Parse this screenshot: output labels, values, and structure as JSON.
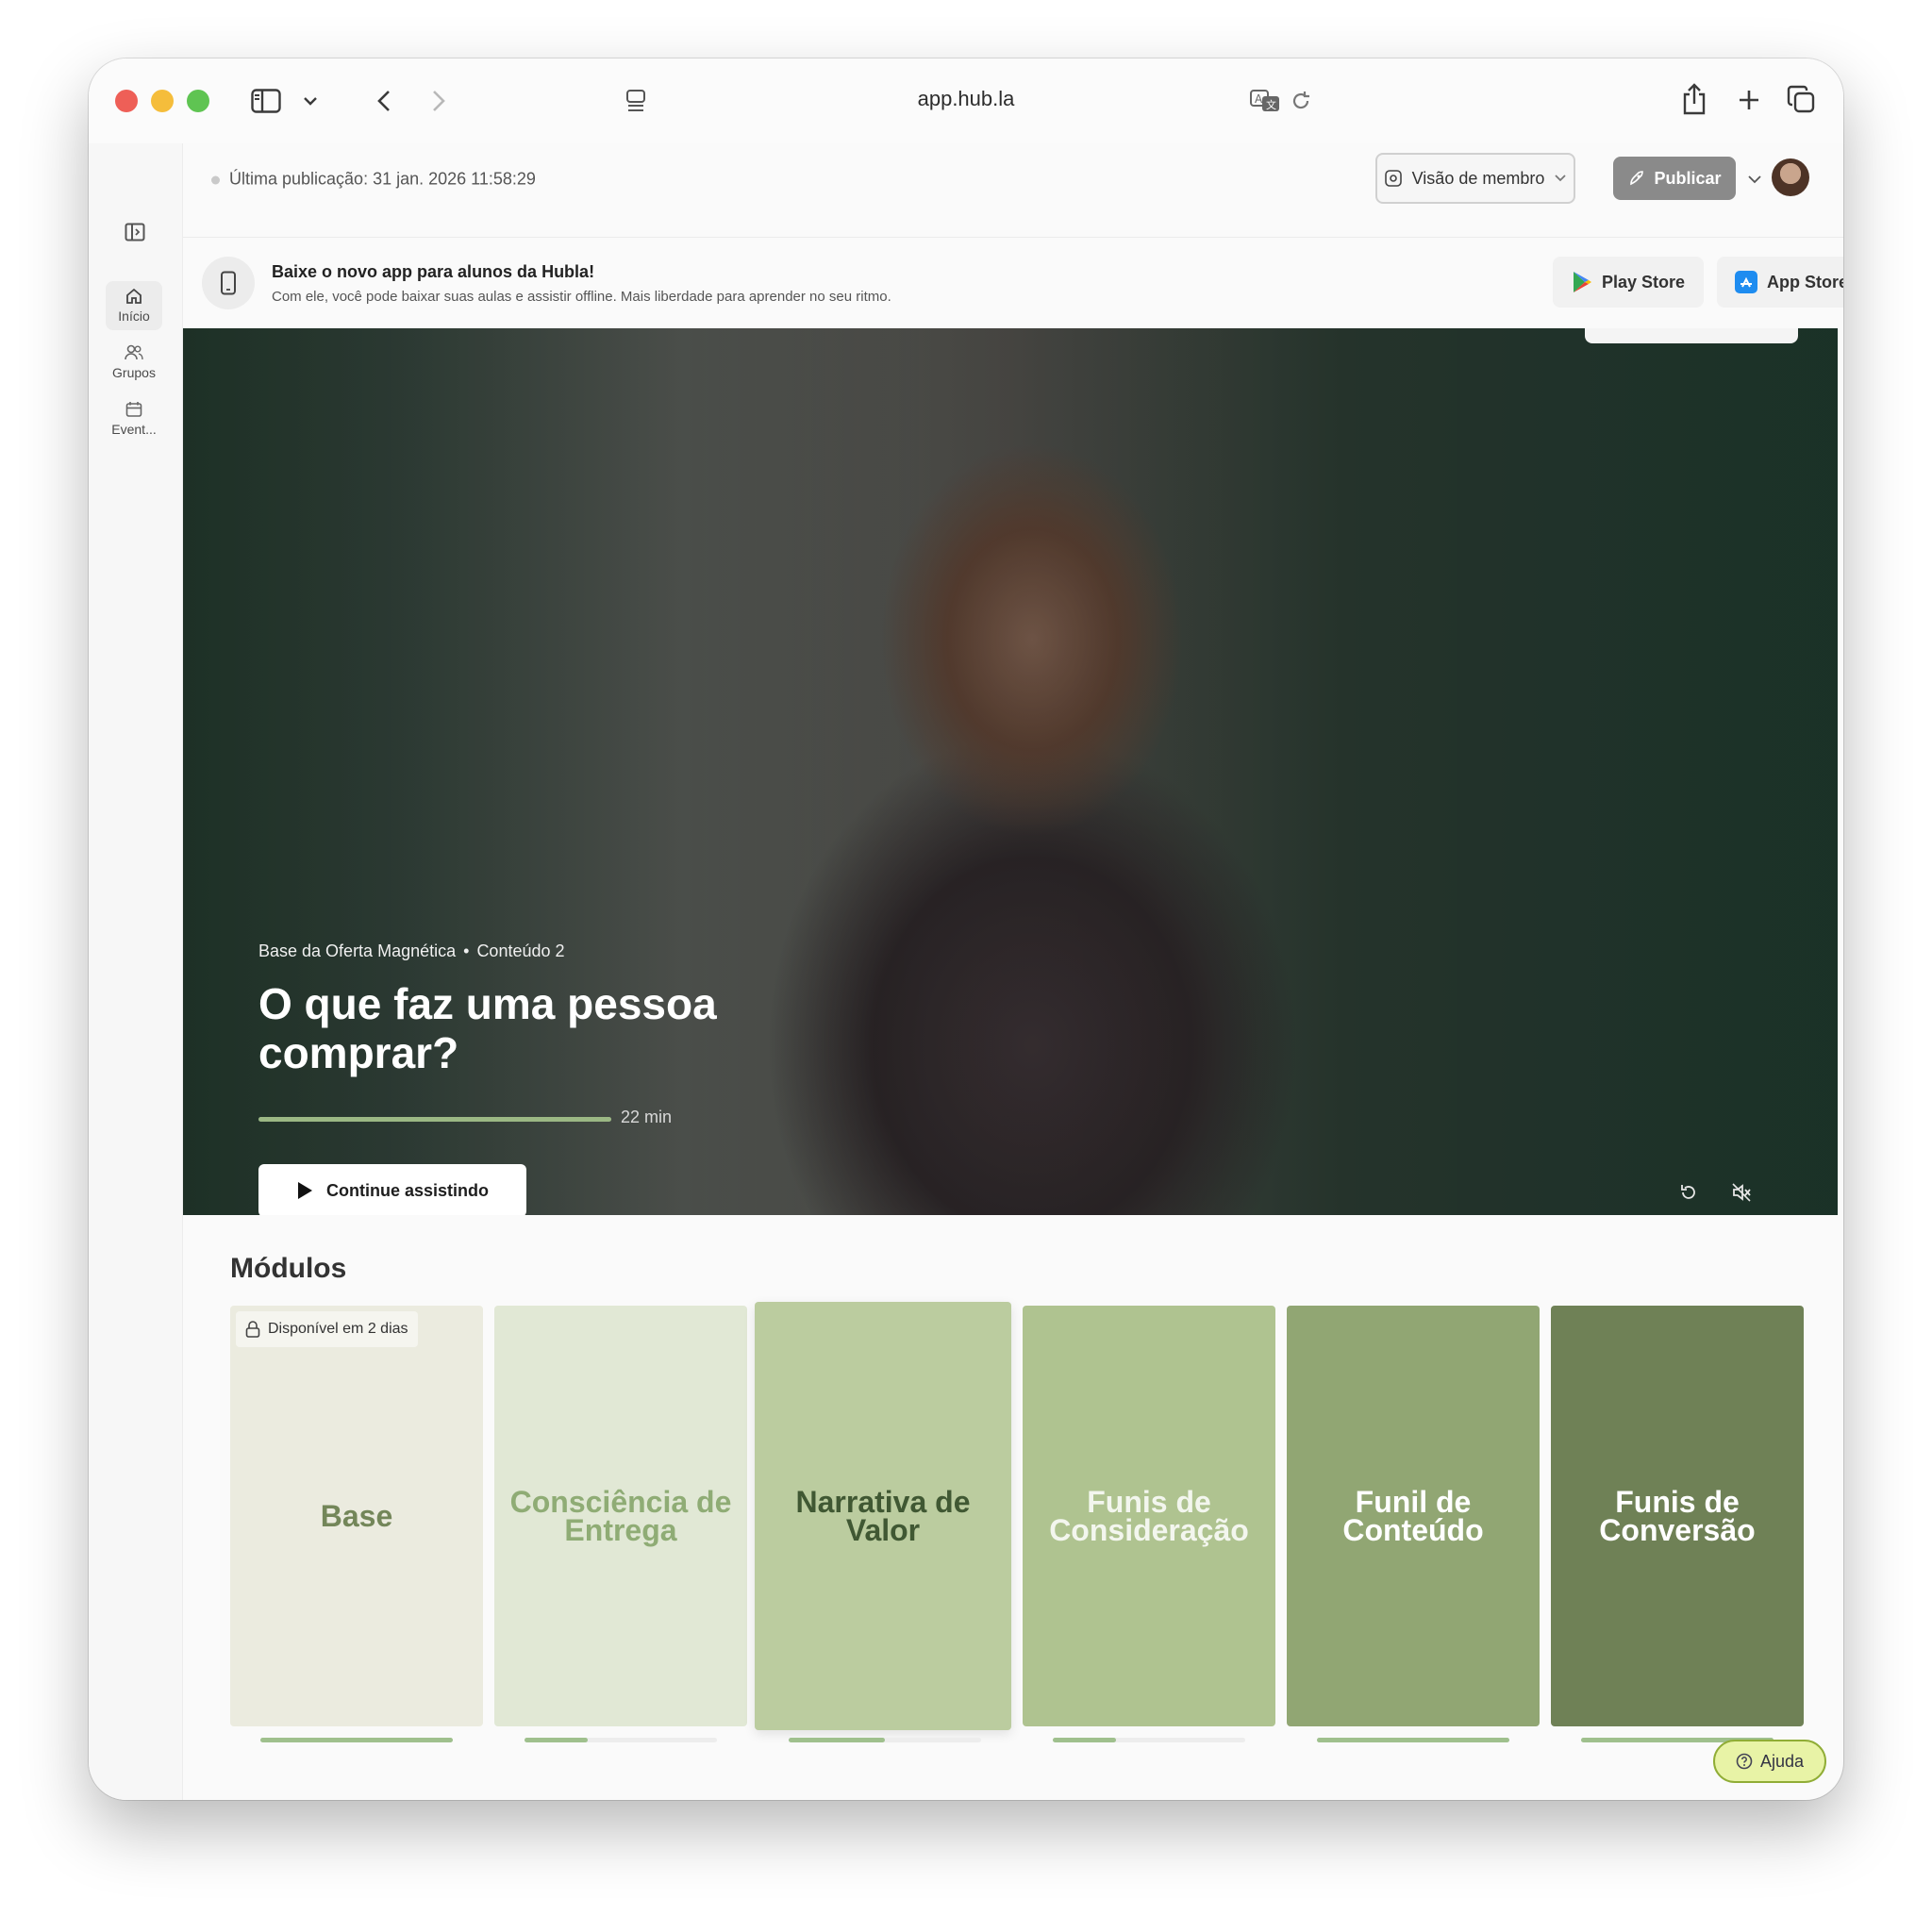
{
  "browser": {
    "url": "app.hub.la"
  },
  "rail": {
    "items": [
      {
        "label": "Início"
      },
      {
        "label": "Grupos"
      },
      {
        "label": "Event..."
      }
    ]
  },
  "status": {
    "last_publication": "Última publicação: 31 jan. 2026 11:58:29",
    "member_view_label": "Visão de membro",
    "publish_label": "Publicar"
  },
  "banner": {
    "title": "Baixe o novo app para alunos da Hubla!",
    "subtitle": "Com ele, você pode baixar suas aulas e assistir offline. Mais liberdade para aprender no seu ritmo.",
    "play_store_label": "Play Store",
    "app_store_label": "App Store"
  },
  "hero": {
    "course": "Base da Oferta Magnética",
    "separator": "•",
    "content": "Conteúdo 2",
    "title": "O que faz uma pessoa comprar?",
    "progress": 1.0,
    "duration": "22 min",
    "continue_label": "Continue assistindo"
  },
  "modules": {
    "heading": "Módulos",
    "lock_badge": "Disponível em 2 dias",
    "items": [
      {
        "title": "Base",
        "bg": "#ebebdf",
        "fg": "#738659",
        "progress": 1.0
      },
      {
        "title": "Consciência de Entrega",
        "bg": "#e1e8d5",
        "fg": "#8fac75",
        "progress": 0.33
      },
      {
        "title": "Narrativa de Valor",
        "bg": "#bbcc9f",
        "fg": "#405833",
        "progress": 0.5
      },
      {
        "title": "Funis de Consideração",
        "bg": "#afc390",
        "fg": "#f3f6ee",
        "progress": 0.33
      },
      {
        "title": "Funil de Conteúdo",
        "bg": "#91a673",
        "fg": "#ffffff",
        "progress": 1.0
      },
      {
        "title": "Funis de Conversão",
        "bg": "#6f8156",
        "fg": "#ffffff",
        "progress": 1.0
      }
    ]
  },
  "help": {
    "label": "Ajuda"
  },
  "colors": {
    "accent_green": "#9bb884",
    "help_bg": "#e8f3a6",
    "help_border": "#90ad36"
  }
}
